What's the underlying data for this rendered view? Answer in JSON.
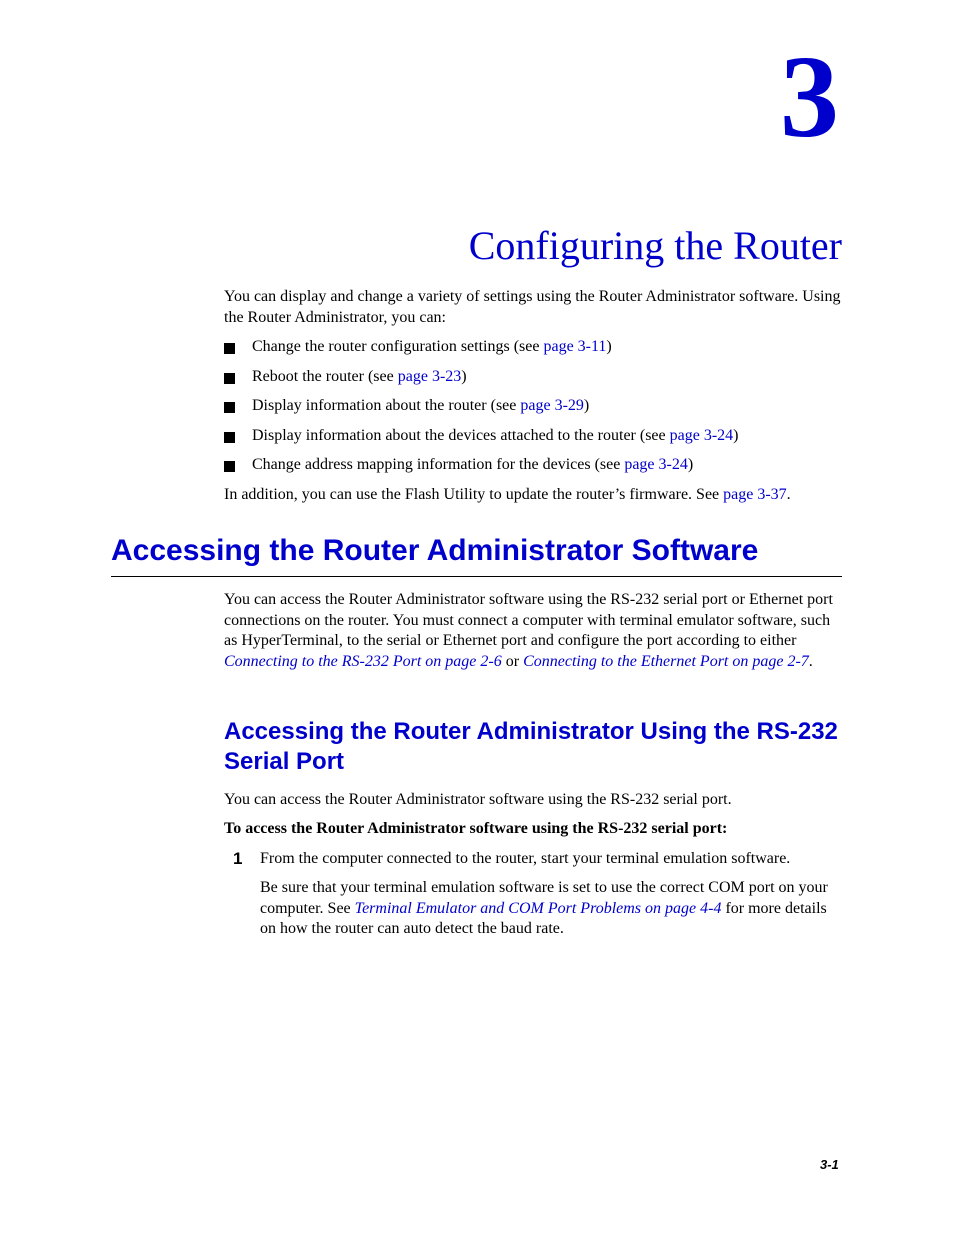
{
  "chapter": {
    "number": "3",
    "title": "Configuring the Router"
  },
  "intro": {
    "text": "You can display and change a variety of settings using the Router Administrator software. Using the Router Administrator, you can:",
    "bullets": [
      {
        "text": "Change the router configuration settings (see ",
        "link": "page 3-11",
        "after": ")"
      },
      {
        "text": "Reboot the router (see ",
        "link": "page 3-23",
        "after": ")"
      },
      {
        "text": "Display information about the router (see ",
        "link": "page 3-29",
        "after": ")"
      },
      {
        "text": "Display information about the devices attached to the router (see ",
        "link": "page 3-24",
        "after": ")"
      },
      {
        "text": "Change address mapping information for the devices (see ",
        "link": "page 3-24",
        "after": ")"
      }
    ],
    "addition": {
      "text": "In addition, you can use the Flash Utility to update the router’s firmware. See ",
      "link": "page 3-37",
      "after": "."
    }
  },
  "section1": {
    "heading": "Accessing the Router Administrator Software",
    "para": {
      "text1": "You can access the Router Administrator software using the RS-232 serial port or Ethernet port connections on the router. You must connect a computer with terminal emulator software, such as HyperTerminal, to the serial or Ethernet port and configure the port according to either ",
      "xref1": "Connecting to the RS-232 Port on page 2-6",
      "mid": " or ",
      "xref2": "Connecting to the Ethernet Port on page 2-7",
      "end": "."
    }
  },
  "section2": {
    "heading": "Accessing the Router Administrator Using the RS-232 Serial Port",
    "intro": "You can access the Router Administrator software using the RS-232 serial port.",
    "procedure_title": "To access the Router Administrator software using the RS-232 serial port:",
    "steps": [
      {
        "number": "1",
        "text": "From the computer connected to the router, start your terminal emulation software.",
        "note": {
          "text1": "Be sure that your terminal emulation software is set to use the correct COM port on your computer. See ",
          "xref": "Terminal Emulator and COM Port Problems on page 4-4",
          "text2": " for more details on how the router can auto detect the baud rate."
        }
      }
    ]
  },
  "footer": {
    "page_number": "3-1"
  }
}
